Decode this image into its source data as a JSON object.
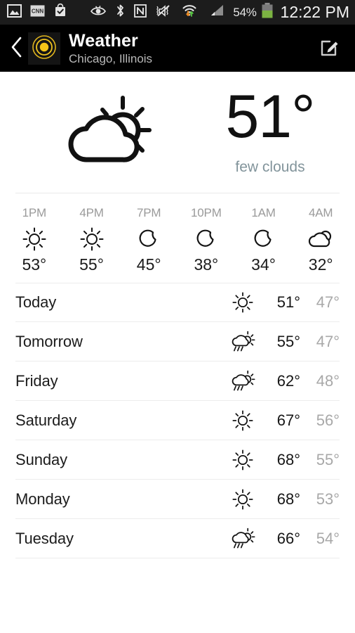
{
  "status_bar": {
    "icons": [
      {
        "name": "gallery-image-icon"
      },
      {
        "name": "cnn-news-icon",
        "label": "CNN"
      },
      {
        "name": "shopping-bag-check-icon"
      },
      {
        "name": "smart-stay-eye-icon"
      },
      {
        "name": "bluetooth-icon"
      },
      {
        "name": "nfc-icon"
      },
      {
        "name": "vibrate-mute-icon"
      },
      {
        "name": "wifi-data-transfer-icon"
      },
      {
        "name": "cellular-signal-icon"
      }
    ],
    "battery_percent": "54%",
    "battery_level": 54,
    "battery_color": "#7cb342",
    "clock": "12:22 PM"
  },
  "action_bar": {
    "back_icon": "back-chevron-icon",
    "app_icon": "weather-sun-rings-icon",
    "app_icon_color": "#f5c518",
    "title": "Weather",
    "subtitle": "Chicago, Illinois",
    "edit_icon": "edit-compose-icon"
  },
  "current": {
    "condition_icon": "few-clouds-icon",
    "temperature": "51",
    "degree": "°",
    "description": "few clouds",
    "description_color": "#82949b"
  },
  "hourly": [
    {
      "time": "1PM",
      "icon": "sun-icon",
      "temp": "53°"
    },
    {
      "time": "4PM",
      "icon": "sun-icon",
      "temp": "55°"
    },
    {
      "time": "7PM",
      "icon": "moon-icon",
      "temp": "45°"
    },
    {
      "time": "10PM",
      "icon": "moon-icon",
      "temp": "38°"
    },
    {
      "time": "1AM",
      "icon": "moon-icon",
      "temp": "34°"
    },
    {
      "time": "4AM",
      "icon": "cloud-moon-icon",
      "temp": "32°"
    }
  ],
  "daily": [
    {
      "day": "Today",
      "icon": "sun-icon",
      "high": "51°",
      "low": "47°"
    },
    {
      "day": "Tomorrow",
      "icon": "rain-sun-icon",
      "high": "55°",
      "low": "47°"
    },
    {
      "day": "Friday",
      "icon": "rain-sun-icon",
      "high": "62°",
      "low": "48°"
    },
    {
      "day": "Saturday",
      "icon": "sun-icon",
      "high": "67°",
      "low": "56°"
    },
    {
      "day": "Sunday",
      "icon": "sun-icon",
      "high": "68°",
      "low": "55°"
    },
    {
      "day": "Monday",
      "icon": "sun-icon",
      "high": "68°",
      "low": "53°"
    },
    {
      "day": "Tuesday",
      "icon": "rain-sun-icon",
      "high": "66°",
      "low": "54°"
    }
  ]
}
